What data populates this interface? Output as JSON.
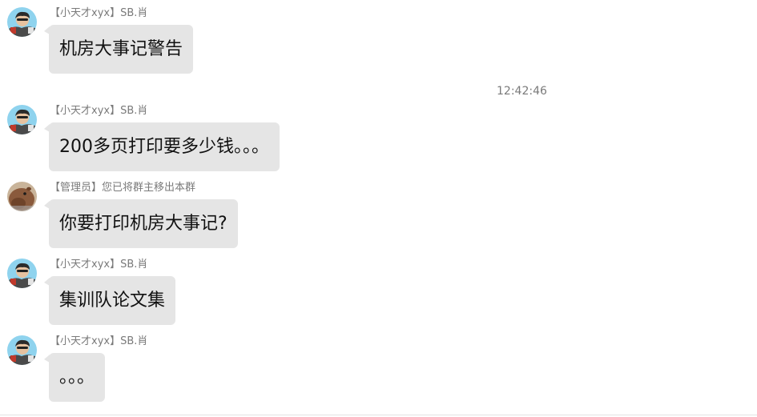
{
  "messages": [
    {
      "sender": "【小天才xyx】SB.肖",
      "text": "机房大事记警告",
      "avatar": "cartoon-guy-avatar"
    },
    {
      "sender": "【小天才xyx】SB.肖",
      "text": "200多页打印要多少钱。。。",
      "avatar": "cartoon-guy-avatar"
    },
    {
      "sender": "【管理员】您已将群主移出本群",
      "text": "你要打印机房大事记?",
      "avatar": "capybara-avatar"
    },
    {
      "sender": "【小天才xyx】SB.肖",
      "text": "集训队论文集",
      "avatar": "cartoon-guy-avatar"
    },
    {
      "sender": "【小天才xyx】SB.肖",
      "text": "。。。",
      "avatar": "cartoon-guy-avatar"
    }
  ],
  "timestamp": "12:42:46",
  "colors": {
    "bubble": "#e5e5e5",
    "meta_text": "#7a7a7a",
    "message_text": "#111111"
  }
}
